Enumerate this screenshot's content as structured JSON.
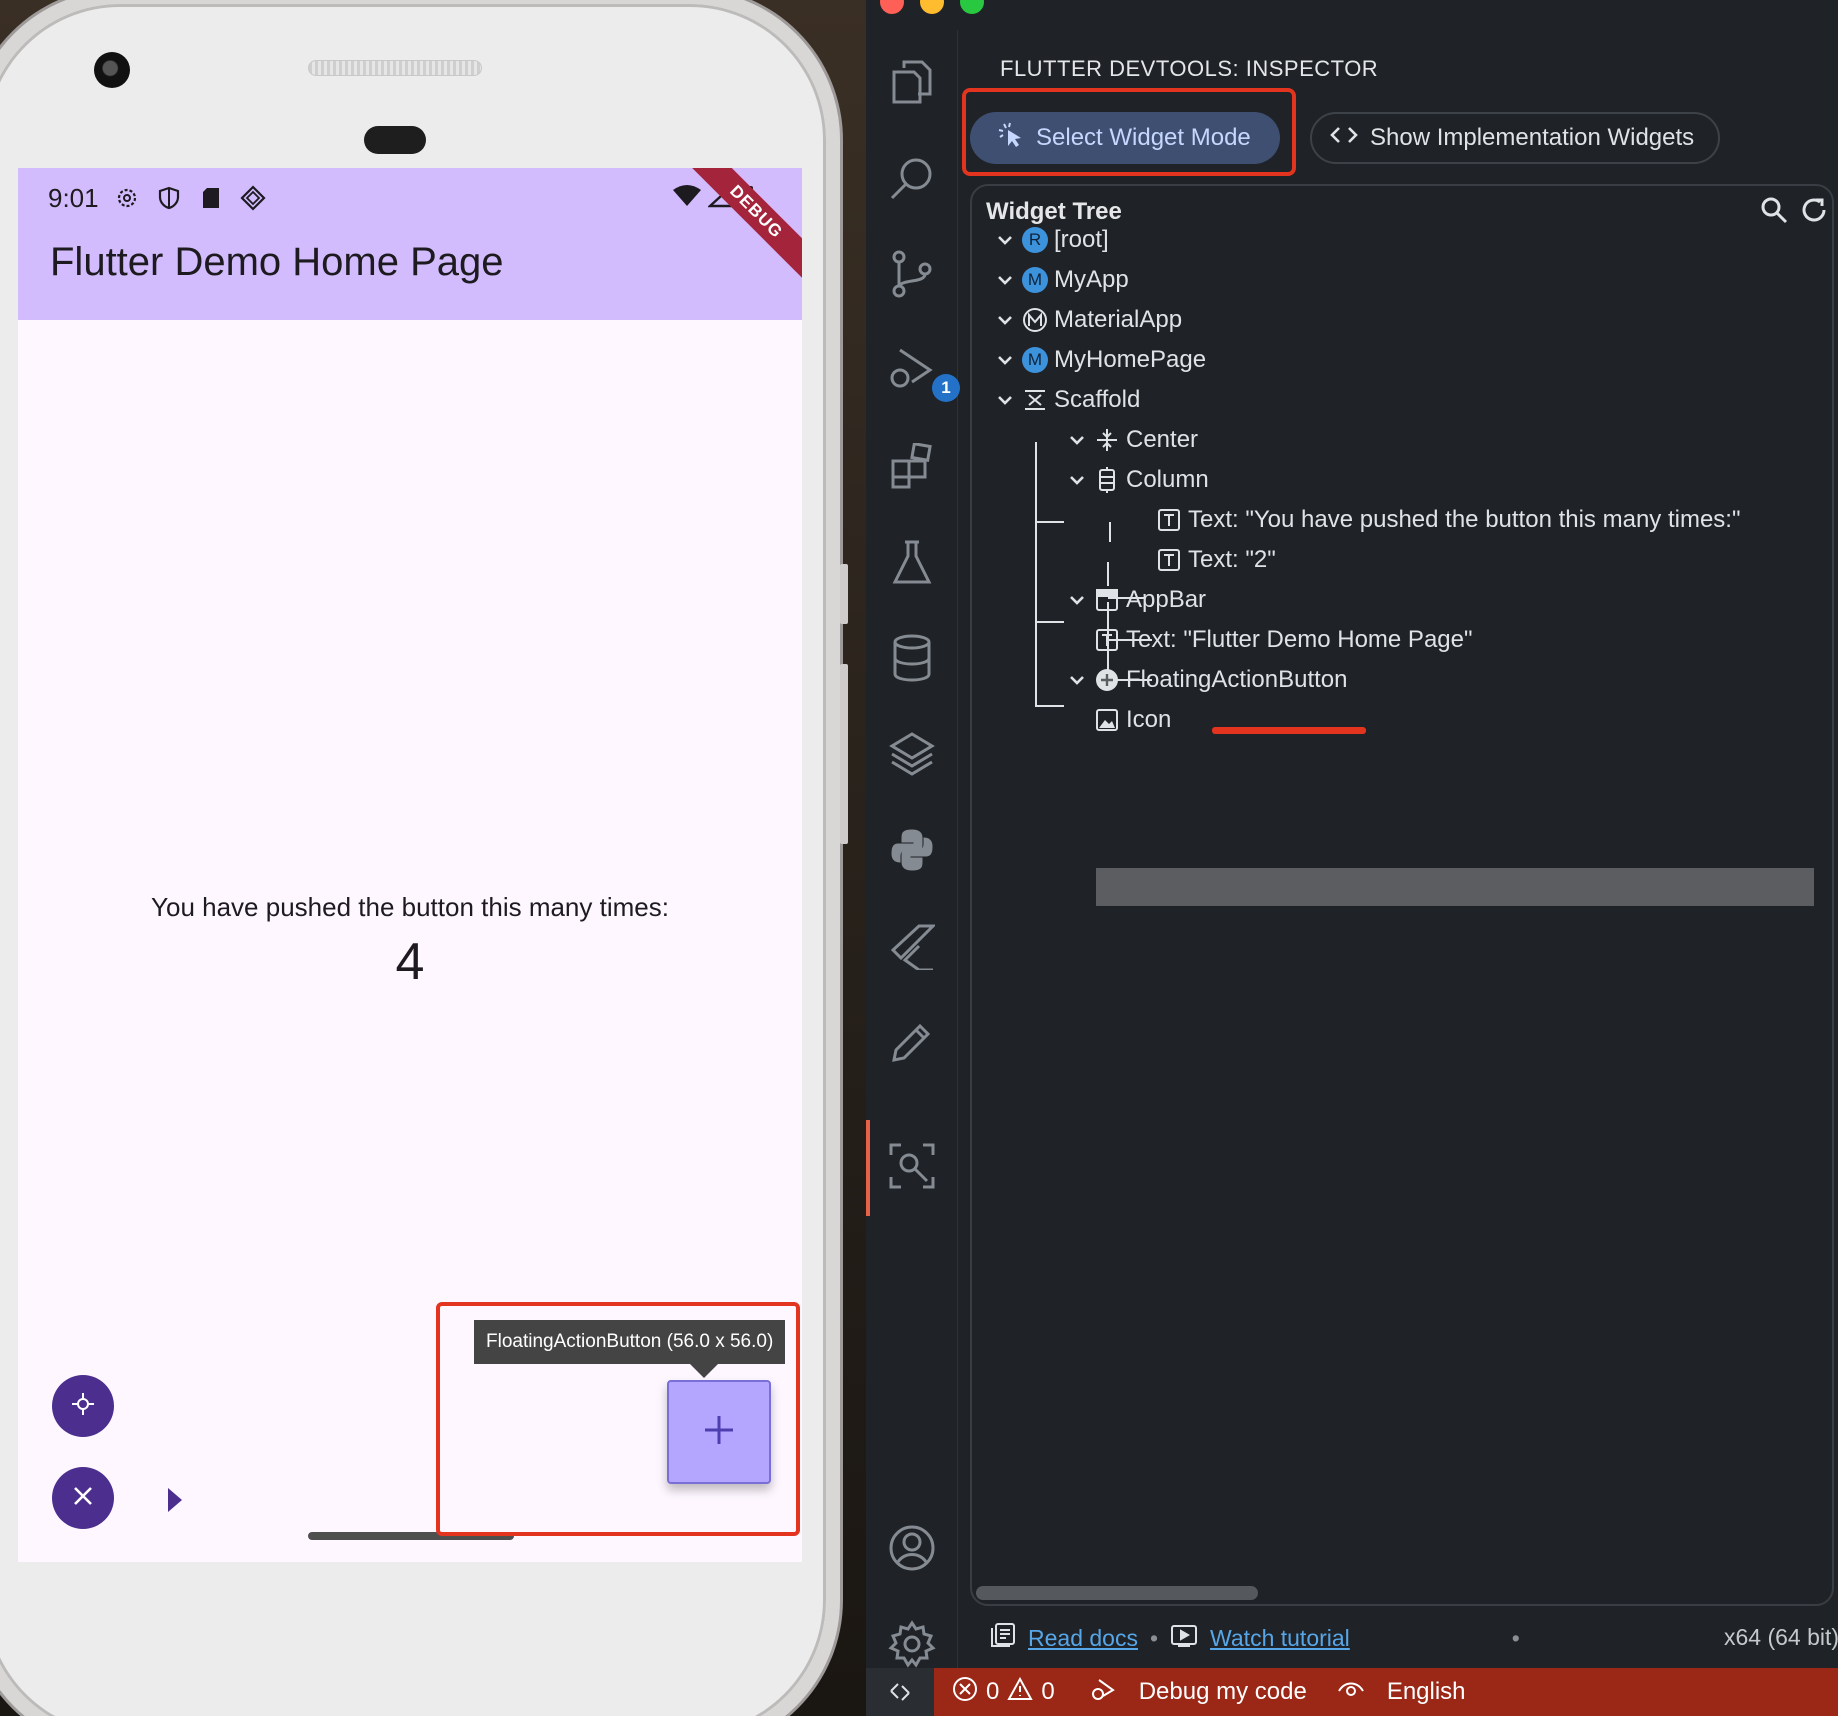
{
  "phone": {
    "status_time": "9:01",
    "app_title": "Flutter Demo Home Page",
    "debug_banner": "DEBUG",
    "counter_label": "You have pushed the button this many times:",
    "counter_value": "4",
    "tooltip": "FloatingActionButton (56.0 x 56.0)",
    "fab_symbol": "+"
  },
  "devtools": {
    "panel_title": "FLUTTER DEVTOOLS: INSPECTOR",
    "select_widget_mode": "Select Widget Mode",
    "show_impl_widgets": "Show Implementation Widgets",
    "tree_title": "Widget Tree",
    "tree": [
      {
        "label": "[root]",
        "icon": "R"
      },
      {
        "label": "MyApp",
        "icon": "M"
      },
      {
        "label": "MaterialApp",
        "icon": "M"
      },
      {
        "label": "MyHomePage",
        "icon": "M"
      },
      {
        "label": "Scaffold",
        "icon": "scaffold"
      },
      {
        "label": "Center",
        "icon": "center"
      },
      {
        "label": "Column",
        "icon": "column"
      },
      {
        "label": "Text: \"You have pushed the button this many times:\"",
        "icon": "T"
      },
      {
        "label": "Text: \"2\"",
        "icon": "T"
      },
      {
        "label": "AppBar",
        "icon": "appbar"
      },
      {
        "label": "Text: \"Flutter Demo Home Page\"",
        "icon": "T"
      },
      {
        "label": "FloatingActionButton",
        "icon": "plus",
        "selected": true
      },
      {
        "label": "Icon",
        "icon": "image"
      }
    ],
    "read_docs": "Read docs",
    "watch_tutorial": "Watch tutorial",
    "arch": "x64 (64 bit)"
  },
  "statusbar": {
    "errors": "0",
    "warnings": "0",
    "debug_label": "Debug my code",
    "language": "English"
  },
  "colors": {
    "accent_red": "#e2341f",
    "status_bar": "#9b2717",
    "appbar": "#d3bcfd",
    "fab": "#b4a6ff"
  }
}
